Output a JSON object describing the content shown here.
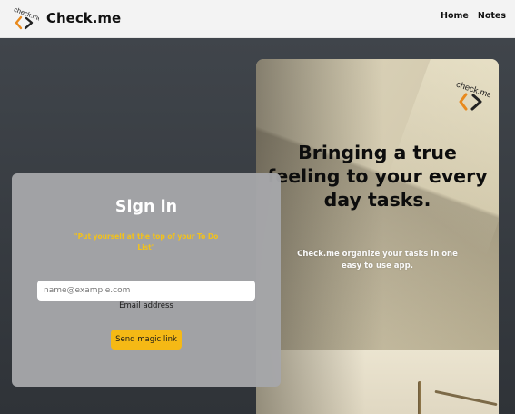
{
  "navbar": {
    "brand_name": "Check.me",
    "brand_logo_text": "check.me",
    "links": [
      {
        "label": "Home"
      },
      {
        "label": "Notes"
      }
    ]
  },
  "hero": {
    "logo_text": "check.me",
    "headline": "Bringing a true feeling to your every day tasks.",
    "subtext": "Check.me organize your tasks in one easy to use app."
  },
  "signin": {
    "title": "Sign in",
    "quote": "\"Put yourself at the top of your To Do List\"",
    "email_placeholder": "name@example.com",
    "email_value": "",
    "email_label": "Email address",
    "submit_label": "Send magic link"
  },
  "colors": {
    "accent": "#f5b915",
    "quote": "#f3c21a",
    "logo_orange": "#e8891c",
    "navbar_bg": "#f3f3f3"
  },
  "icons": {
    "brand": "check-me-logo-icon"
  }
}
